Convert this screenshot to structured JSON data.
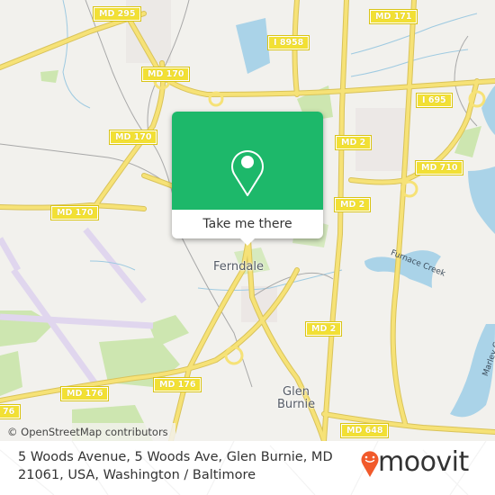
{
  "map": {
    "road_labels": [
      {
        "id": "md295",
        "text": "MD 295"
      },
      {
        "id": "md170-a",
        "text": "MD 170"
      },
      {
        "id": "md170-b",
        "text": "MD 170"
      },
      {
        "id": "md170-c",
        "text": "MD 170"
      },
      {
        "id": "i8958",
        "text": "I 8958"
      },
      {
        "id": "md171",
        "text": "MD 171"
      },
      {
        "id": "i695",
        "text": "I 695"
      },
      {
        "id": "md2-a",
        "text": "MD 2"
      },
      {
        "id": "md2-b",
        "text": "MD 2"
      },
      {
        "id": "md2-c",
        "text": "MD 2"
      },
      {
        "id": "md710",
        "text": "MD 710"
      },
      {
        "id": "md176-a",
        "text": "MD 176"
      },
      {
        "id": "md176-b",
        "text": "MD 176"
      },
      {
        "id": "md176-c",
        "text": "76"
      },
      {
        "id": "md648",
        "text": "MD 648"
      }
    ],
    "place_labels": {
      "ferndale": "Ferndale",
      "glen_burnie_line1": "Glen",
      "glen_burnie_line2": "Burnie"
    },
    "water_labels": {
      "furnace_creek": "Furnace Creek",
      "marley_creek": "Marley Creek"
    },
    "attribution": "© OpenStreetMap contributors"
  },
  "popup": {
    "icon": "map-pin-icon",
    "button_label": "Take me there",
    "color": "#1db86a"
  },
  "footer": {
    "address_line1": "5 Woods Avenue, 5 Woods Ave, Glen Burnie, MD",
    "address_line2": "21061, USA, Washington / Baltimore",
    "logo_text": "moovit",
    "logo_icon": "moovit-pin-icon",
    "logo_color": "#f15a2b"
  }
}
